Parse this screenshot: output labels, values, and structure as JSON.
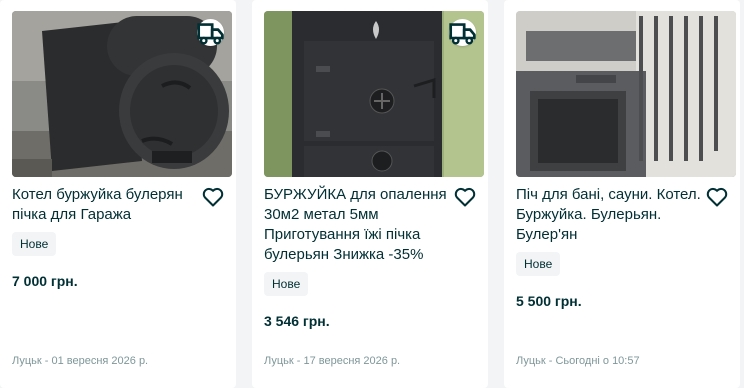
{
  "listings": [
    {
      "title": "Котел буржуйка булерян пічка для Гаража",
      "condition": "Нове",
      "price": "7 000 грн.",
      "location_date": "Луцьк - 01 вересня 2026 р.",
      "has_delivery": true
    },
    {
      "title": "БУРЖУЙКА для опалення 30м2 метал 5мм Приготування їжі пічка булерьян Знижка -35%",
      "condition": "Нове",
      "price": "3 546 грн.",
      "location_date": "Луцьк - 17 вересня 2026 р.",
      "has_delivery": true
    },
    {
      "title": "Піч для бані, сауни. Котел. Буржуйка. Булерьян. Булер'ян",
      "condition": "Нове",
      "price": "5 500 грн.",
      "location_date": "Луцьк - Сьогодні о 10:57",
      "has_delivery": false
    }
  ],
  "icons": {
    "delivery": "truck-icon",
    "favorite": "heart-outline-icon"
  },
  "colors": {
    "text": "#002f34",
    "muted": "#7f9799",
    "badge_bg": "#f2f4f5",
    "page_bg": "#f2f4f5"
  }
}
